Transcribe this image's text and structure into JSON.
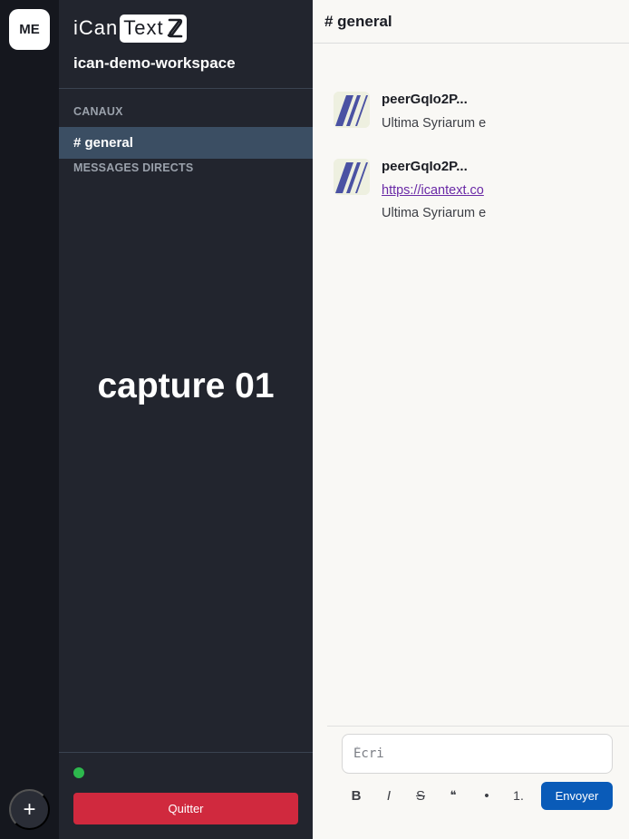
{
  "rail": {
    "workspace_initials": "ME",
    "add_label": "+"
  },
  "sidebar": {
    "logo": {
      "left_text": "iCan",
      "boxed_text": "Text"
    },
    "workspace_name": "ican-demo-workspace",
    "channels_label": "CANAUX",
    "channels": [
      {
        "label": "# general",
        "active": true
      }
    ],
    "dm_label": "MESSAGES DIRECTS",
    "overlay": "capture 01",
    "status_color": "#2db84d",
    "quit_label": "Quitter"
  },
  "main": {
    "channel_title": "# general",
    "messages": [
      {
        "author": "peerGqIo2P...",
        "text": "Ultima Syriarum e"
      },
      {
        "author": "peerGqIo2P...",
        "link": "https://icantext.co",
        "text": "Ultima Syriarum e"
      }
    ],
    "composer": {
      "placeholder": "Écri",
      "value": "",
      "format_buttons": {
        "bold": "B",
        "italic": "I",
        "strike": "S",
        "quote": "❝",
        "bullet": "•",
        "ordered": "1."
      },
      "send_label": "Envoyer"
    }
  },
  "colors": {
    "rail_bg": "#15171e",
    "sidebar_bg": "#22252e",
    "active_channel_bg": "#3b4e63",
    "quit_bg": "#d0293e",
    "send_bg": "#0a5bb8",
    "main_bg": "#f9f8f5",
    "link": "#6a2aa6"
  }
}
